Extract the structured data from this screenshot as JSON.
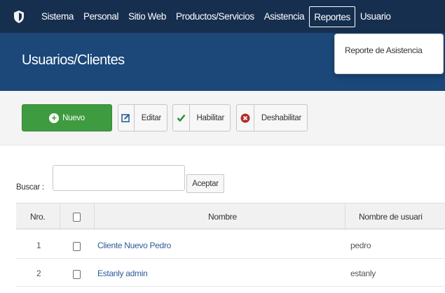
{
  "navbar": {
    "items": [
      {
        "label": "Sistema"
      },
      {
        "label": "Personal"
      },
      {
        "label": "Sitio Web"
      },
      {
        "label": "Productos/Servicios"
      },
      {
        "label": "Asistencia"
      },
      {
        "label": "Reportes"
      },
      {
        "label": "Usuario"
      }
    ],
    "active_index": 5
  },
  "dropdown": {
    "items": [
      {
        "label": "Reporte de Asistencia"
      }
    ]
  },
  "header": {
    "title": "Usuarios/Clientes"
  },
  "toolbar": {
    "new_label": "Nuevo",
    "edit_label": "Editar",
    "enable_label": "Habilitar",
    "disable_label": "Deshabilitar"
  },
  "search": {
    "label": "Buscar :",
    "value": "",
    "button_label": "Aceptar"
  },
  "table": {
    "columns": [
      "Nro.",
      "",
      "Nombre",
      "Nombre de usuari"
    ],
    "rows": [
      {
        "nro": "1",
        "nombre": "Cliente Nuevo Pedro",
        "usuario": "pedro"
      },
      {
        "nro": "2",
        "nombre": "Estanly admin",
        "usuario": "estanly"
      }
    ]
  },
  "colors": {
    "navbar_bg": "#162f4f",
    "header_bg": "#1b4779",
    "new_button": "#3f9b3f",
    "link": "#2d5b9a",
    "edit_icon": "#2b5f9e",
    "enable_icon": "#2e8b2e",
    "disable_icon": "#b32b2b"
  },
  "icons": {
    "logo": "shield-logo-icon",
    "new": "plus-circle-icon",
    "edit": "edit-icon",
    "enable": "check-icon",
    "disable": "x-circle-icon"
  }
}
